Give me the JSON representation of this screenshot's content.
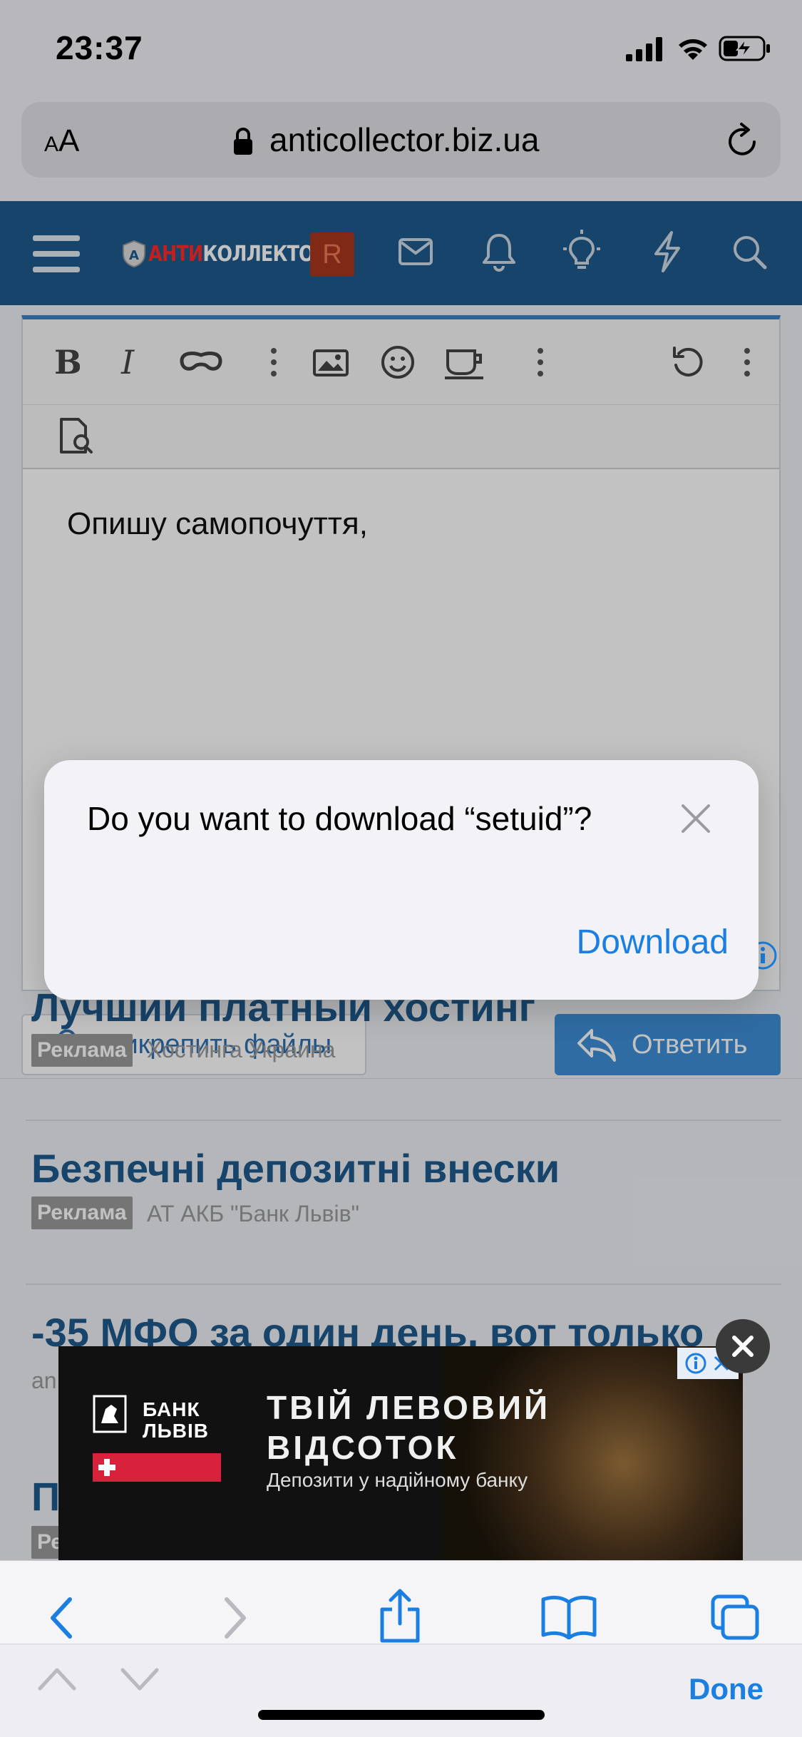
{
  "status_bar": {
    "time": "23:37"
  },
  "browser": {
    "aa_label_small": "A",
    "aa_label_big": "A",
    "url": "anticollector.biz.ua"
  },
  "site": {
    "logo_text_red": "АНТИ",
    "logo_text_white": "КОЛЛЕКТОР",
    "avatar_letter": "R"
  },
  "editor": {
    "text": "Опишу самопочуття,",
    "attach_label": "Прикрепить файлы",
    "reply_label": "Ответить"
  },
  "ads": [
    {
      "title": "Лучший платный хостинг",
      "tag": "Реклама",
      "source": "Хостинга Украина"
    },
    {
      "title": "Безпечні депозитні внески",
      "tag": "Реклама",
      "source": "АТ АКБ \"Банк Львів\""
    },
    {
      "title": "-35 МФО за один день, вот только",
      "tag": "",
      "source": "an"
    },
    {
      "title": "П",
      "tag": "Ре",
      "source": ""
    }
  ],
  "banner": {
    "bank_name_1": "БАНК",
    "bank_name_2": "ЛЬВІВ",
    "headline_1": "ТВІЙ ЛЕВОВИЙ",
    "headline_2": "ВІДСОТОК",
    "subline": "Депозити у надійному банку"
  },
  "dialog": {
    "message": "Do you want to download “setuid”?",
    "action": "Download"
  },
  "bottom_toolbar": {
    "done_label": "Done"
  }
}
